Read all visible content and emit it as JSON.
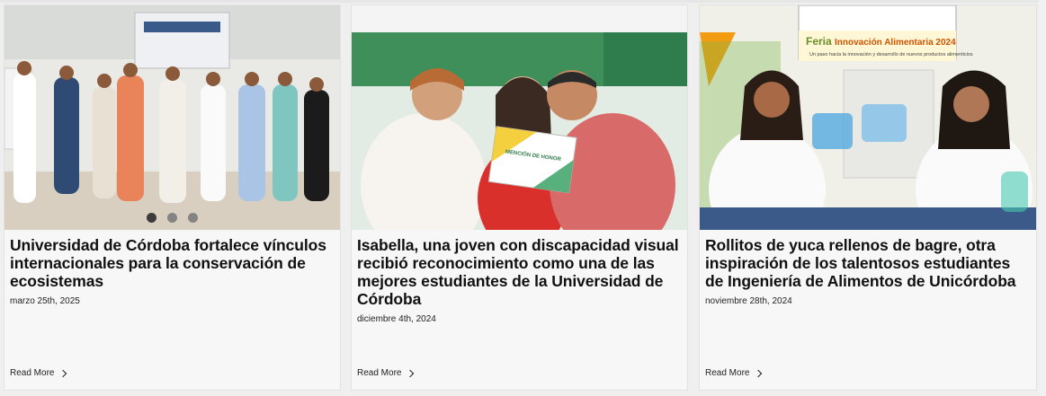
{
  "cards": [
    {
      "title": "Universidad de Córdoba fortalece vínculos internacionales para la conservación de ecosistemas",
      "date": "marzo 25th, 2025",
      "read_more": "Read More",
      "image_alt_icon": "photo-group-event",
      "carousel_dots": 3
    },
    {
      "title": "Isabella, una joven con discapacidad visual recibió reconocimiento como una de las mejores estudiantes de la Universidad de Córdoba",
      "date": "diciembre 4th, 2024",
      "read_more": "Read More",
      "image_alt_icon": "photo-award-ceremony",
      "certificate_text": "MENCIÓN DE HONOR"
    },
    {
      "title": "Rollitos de yuca rellenos de bagre, otra inspiración de los talentosos estudiantes de Ingeniería de Alimentos de Unicórdoba",
      "date": "noviembre 28th, 2024",
      "read_more": "Read More",
      "image_alt_icon": "photo-food-fair",
      "banner_line1": "Feria",
      "banner_line2": "Innovación Alimentaria 2024",
      "banner_sub": "Un paso hacia la innovación y desarrollo de nuevos productos alimenticios"
    }
  ],
  "colors": {
    "accent_green": "#7ab648",
    "text": "#111111"
  }
}
